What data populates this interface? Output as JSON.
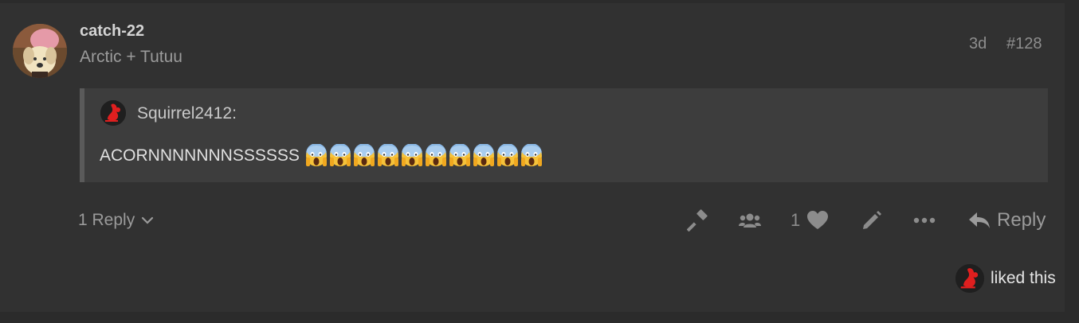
{
  "post": {
    "author_name": "catch-22",
    "author_title": "Arctic + Tutuu",
    "date": "3d",
    "post_number": "#128",
    "quote": {
      "username": "Squirrel2412:",
      "text": "ACORNNNNNNNSSSSSS",
      "emoji_count": 10,
      "emoji_name": "face-screaming-in-fear"
    },
    "replies_label": "1 Reply",
    "like_count": "1",
    "reply_label": "Reply",
    "liked_by_text": "liked this"
  },
  "colors": {
    "background": "#2b2b2b",
    "post_background": "#313131",
    "quote_background": "#3d3d3d",
    "accent_red": "#e01f1f"
  }
}
